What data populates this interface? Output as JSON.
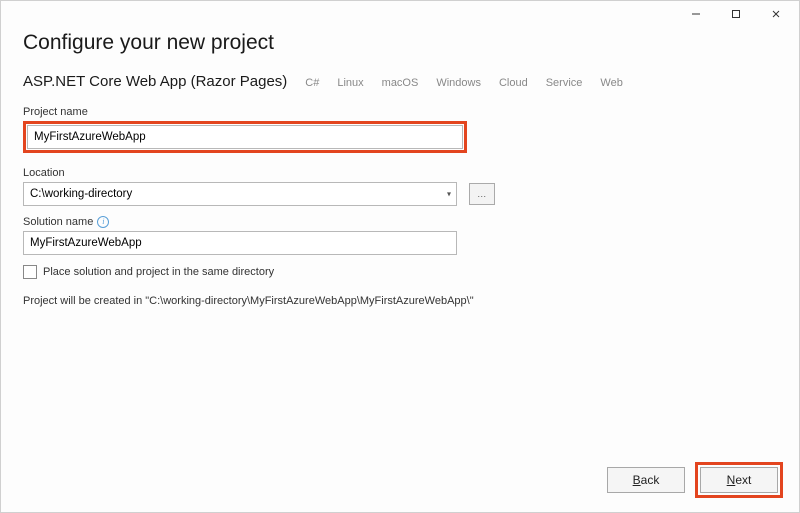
{
  "window": {
    "title": "Configure your new project",
    "template_name": "ASP.NET Core Web App (Razor Pages)",
    "tags": [
      "C#",
      "Linux",
      "macOS",
      "Windows",
      "Cloud",
      "Service",
      "Web"
    ]
  },
  "fields": {
    "project_name": {
      "label": "Project name",
      "value": "MyFirstAzureWebApp"
    },
    "location": {
      "label": "Location",
      "value": "C:\\working-directory",
      "browse_label": "..."
    },
    "solution_name": {
      "label": "Solution name",
      "value": "MyFirstAzureWebApp"
    },
    "same_directory": {
      "label": "Place solution and project in the same directory",
      "checked": false
    }
  },
  "note": "Project will be created in \"C:\\working-directory\\MyFirstAzureWebApp\\MyFirstAzureWebApp\\\"",
  "buttons": {
    "back": "Back",
    "next": "Next"
  }
}
